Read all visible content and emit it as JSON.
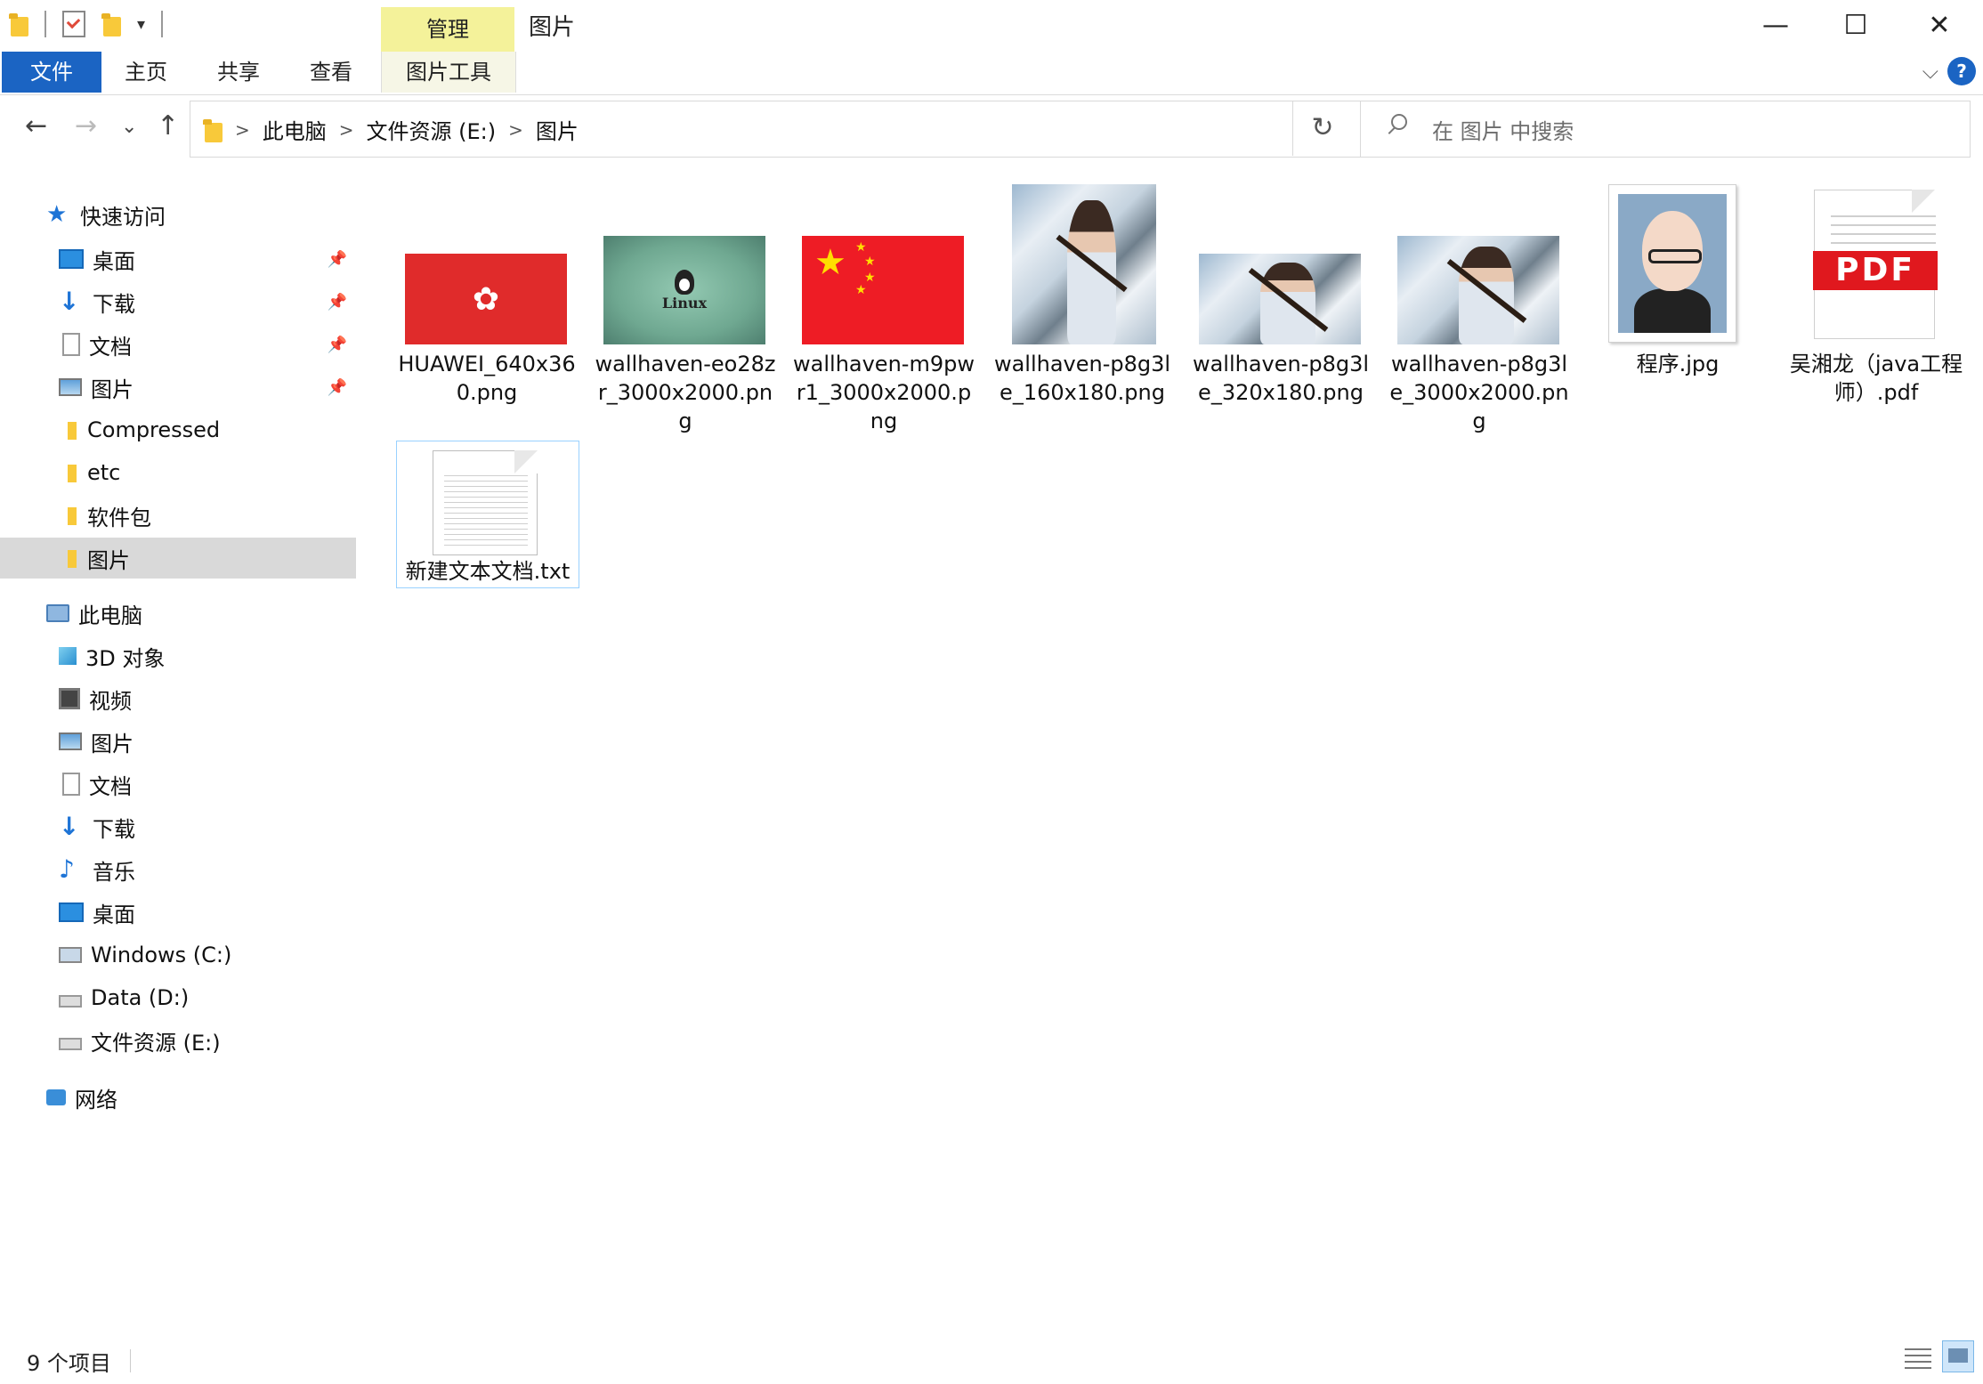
{
  "window": {
    "title": "图片",
    "manage_tab": "管理",
    "minimize": "—",
    "maximize": "☐",
    "close": "✕"
  },
  "ribbon": {
    "tabs": [
      "文件",
      "主页",
      "共享",
      "查看",
      "图片工具"
    ],
    "collapse": "⌵",
    "help": "?"
  },
  "nav": {
    "back": "←",
    "forward": "→",
    "recent": "⌄",
    "up": "↑"
  },
  "address": {
    "segments": [
      "此电脑",
      "文件资源 (E:)",
      "图片"
    ],
    "separator": ">",
    "dropdown": "⌵",
    "refresh": "↻"
  },
  "search": {
    "placeholder": "在 图片 中搜索"
  },
  "sidebar": {
    "quick_access": "快速访问",
    "quick_items": [
      {
        "label": "桌面",
        "icon": "desktop-icon",
        "pinned": true
      },
      {
        "label": "下载",
        "icon": "download-icon",
        "pinned": true
      },
      {
        "label": "文档",
        "icon": "document-icon",
        "pinned": true
      },
      {
        "label": "图片",
        "icon": "pictures-icon",
        "pinned": true
      },
      {
        "label": "Compressed",
        "icon": "folder-icon",
        "pinned": false
      },
      {
        "label": "etc",
        "icon": "folder-icon",
        "pinned": false
      },
      {
        "label": "软件包",
        "icon": "folder-icon",
        "pinned": false
      },
      {
        "label": "图片",
        "icon": "folder-icon",
        "pinned": false,
        "selected": true
      }
    ],
    "this_pc": "此电脑",
    "pc_items": [
      {
        "label": "3D 对象",
        "icon": "3d-objects-icon"
      },
      {
        "label": "视频",
        "icon": "video-icon"
      },
      {
        "label": "图片",
        "icon": "pictures-icon"
      },
      {
        "label": "文档",
        "icon": "document-icon"
      },
      {
        "label": "下载",
        "icon": "download-icon"
      },
      {
        "label": "音乐",
        "icon": "music-icon"
      },
      {
        "label": "桌面",
        "icon": "desktop-icon"
      },
      {
        "label": "Windows (C:)",
        "icon": "windows-drive-icon"
      },
      {
        "label": "Data (D:)",
        "icon": "drive-icon"
      },
      {
        "label": "文件资源 (E:)",
        "icon": "drive-icon"
      }
    ],
    "network": "网络"
  },
  "files": [
    {
      "name": "HUAWEI_640x360.png",
      "thumb": "huawei-logo"
    },
    {
      "name": "wallhaven-eo28zr_3000x2000.png",
      "thumb": "linux-tux"
    },
    {
      "name": "wallhaven-m9pwr1_3000x2000.png",
      "thumb": "china-flag",
      "linux_text": "Linux"
    },
    {
      "name": "wallhaven-p8g3le_160x180.png",
      "thumb": "photo-swordswoman"
    },
    {
      "name": "wallhaven-p8g3le_320x180.png",
      "thumb": "photo-swordswoman"
    },
    {
      "name": "wallhaven-p8g3le_3000x2000.png",
      "thumb": "photo-swordswoman"
    },
    {
      "name": "程序.jpg",
      "thumb": "avatar-caricature"
    },
    {
      "name": "吴湘龙（java工程师）.pdf",
      "thumb": "pdf-document",
      "pdf_label": "PDF"
    },
    {
      "name": "新建文本文档.txt",
      "thumb": "text-document",
      "selected": true
    }
  ],
  "status": {
    "item_count": "9 个项目"
  },
  "colors": {
    "accent": "#1b64c3",
    "manage_tab": "#f4f29a",
    "selection": "#d9d9d9",
    "huawei_red": "#e02b2b",
    "flag_red": "#ee1c25",
    "pdf_red": "#e0181e"
  }
}
